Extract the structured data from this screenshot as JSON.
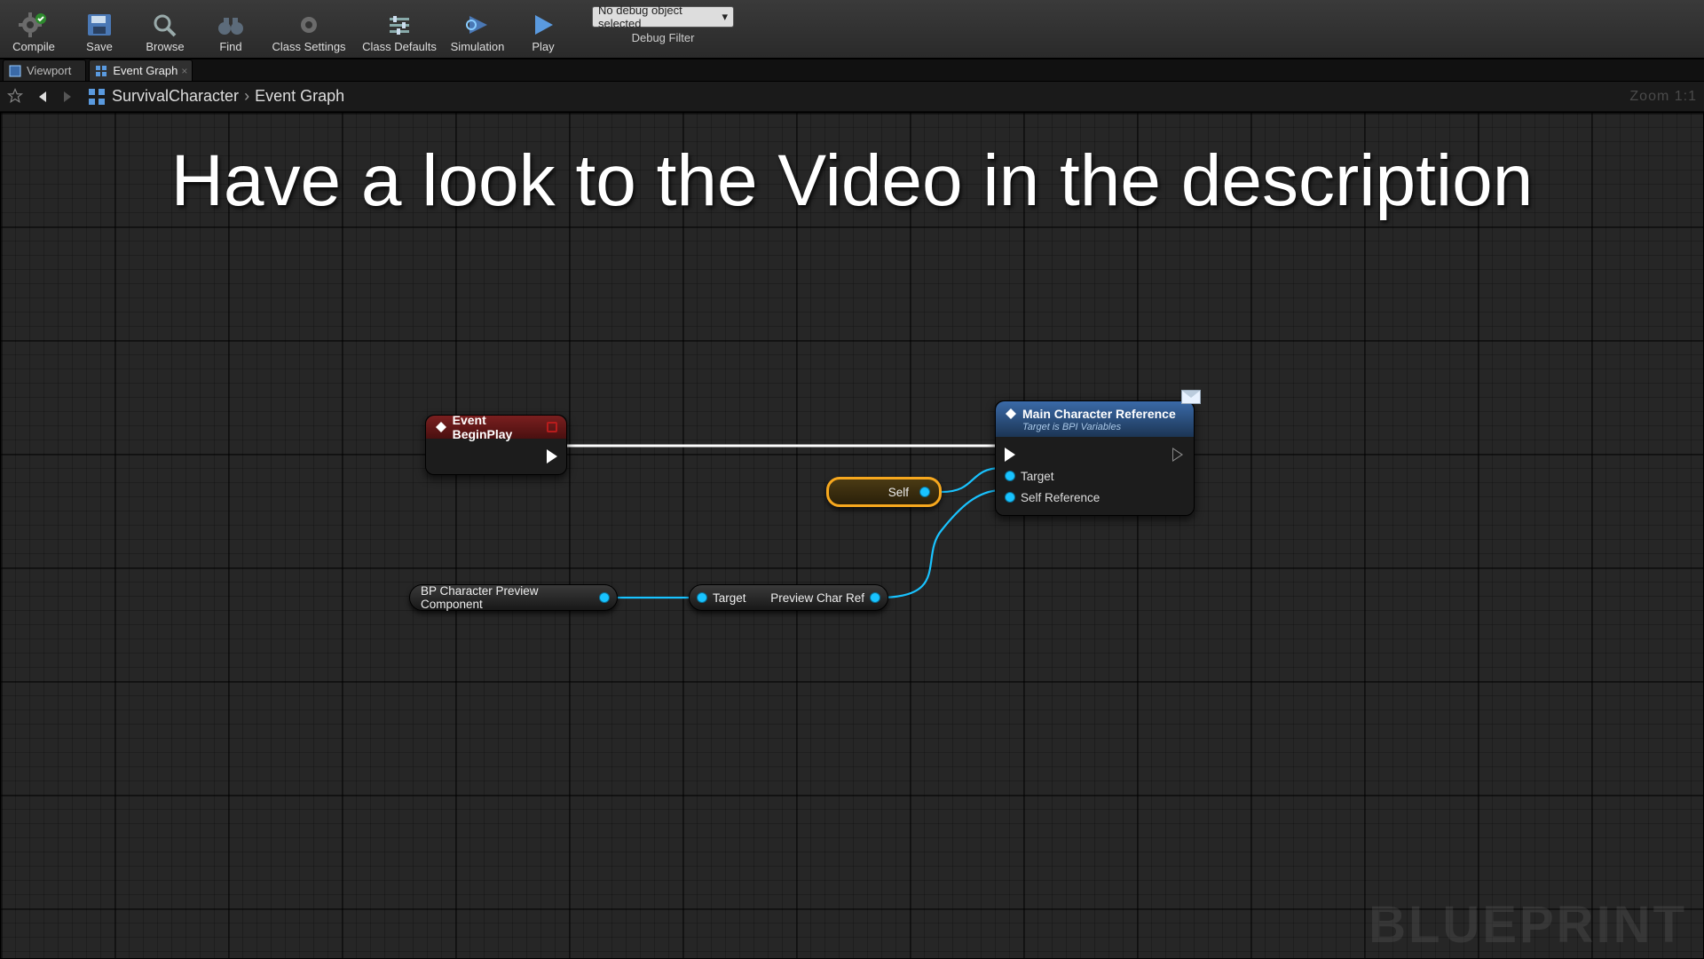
{
  "toolbar": {
    "compile": "Compile",
    "save": "Save",
    "browse": "Browse",
    "find": "Find",
    "class_settings": "Class Settings",
    "class_defaults": "Class Defaults",
    "simulation": "Simulation",
    "play": "Play",
    "debug_selected": "No debug object selected",
    "debug_filter_label": "Debug Filter"
  },
  "tabs": {
    "viewport": "Viewport",
    "event_graph": "Event Graph"
  },
  "breadcrumb": {
    "blueprint_name": "SurvivalCharacter",
    "graph_name": "Event Graph",
    "zoom_label": "Zoom 1:1"
  },
  "overlay": {
    "text": "Have a look to the Video in the description"
  },
  "watermark": "BLUEPRINT",
  "nodes": {
    "event_begin_play": {
      "title": "Event BeginPlay"
    },
    "main_char_ref": {
      "title": "Main Character Reference",
      "subtitle": "Target is BPI Variables",
      "pin_target": "Target",
      "pin_self_ref": "Self Reference"
    },
    "self_pill": {
      "label": "Self"
    },
    "bp_preview_comp": {
      "label": "BP Character Preview Component"
    },
    "getter_pill": {
      "in_label": "Target",
      "out_label": "Preview Char Ref"
    }
  }
}
